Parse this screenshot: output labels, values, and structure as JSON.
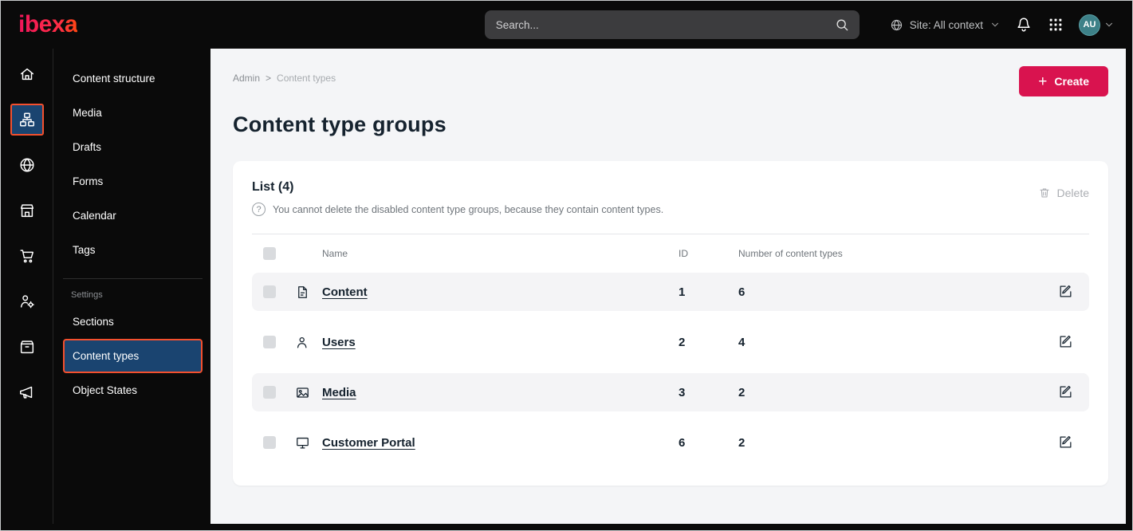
{
  "topbar": {
    "logo_text": "ibexa",
    "search_placeholder": "Search...",
    "site_selector": "Site: All context",
    "avatar_initials": "AU"
  },
  "icon_sidebar": {
    "items": [
      "home",
      "content-structure",
      "site",
      "storefront",
      "commerce",
      "user-settings",
      "catalog",
      "marketing"
    ],
    "active": "content-structure"
  },
  "menu": {
    "items": [
      "Content structure",
      "Media",
      "Drafts",
      "Forms",
      "Calendar",
      "Tags"
    ],
    "settings_heading": "Settings",
    "settings_items": [
      "Sections",
      "Content types",
      "Object States"
    ],
    "active_item": "Content types"
  },
  "breadcrumb": {
    "root": "Admin",
    "separator": ">",
    "current": "Content types"
  },
  "page": {
    "title": "Content type groups",
    "create_plus": "+",
    "create_button": "Create"
  },
  "list_card": {
    "heading": "List (4)",
    "info_icon": "?",
    "info": "You cannot delete the disabled content type groups, because they contain content types.",
    "delete_button": "Delete",
    "columns": {
      "name": "Name",
      "id": "ID",
      "count": "Number of content types"
    },
    "rows": [
      {
        "icon": "page-icon",
        "name": "Content",
        "id": "1",
        "count": "6"
      },
      {
        "icon": "user-icon",
        "name": "Users",
        "id": "2",
        "count": "4"
      },
      {
        "icon": "image-icon",
        "name": "Media",
        "id": "3",
        "count": "2"
      },
      {
        "icon": "monitor-icon",
        "name": "Customer Portal",
        "id": "6",
        "count": "2"
      }
    ]
  },
  "colors": {
    "accent_pink": "#d9134f",
    "highlight_orange": "#f4502e",
    "active_blue": "#1a4470",
    "avatar_teal": "#3d8188",
    "main_bg": "#f4f5f7"
  }
}
